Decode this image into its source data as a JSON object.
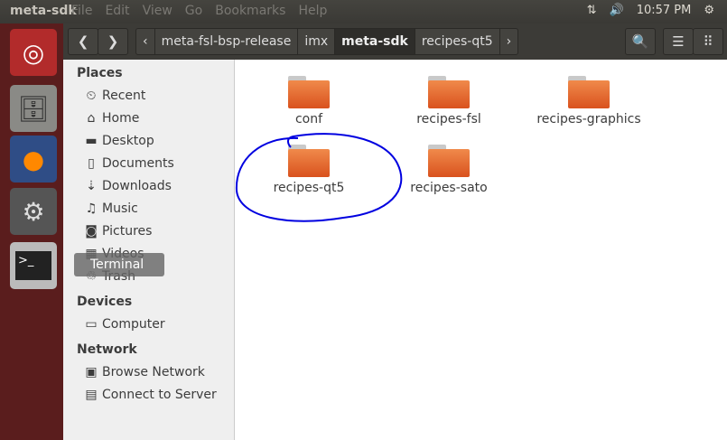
{
  "window_title": "meta-sdk",
  "menu": [
    "File",
    "Edit",
    "View",
    "Go",
    "Bookmarks",
    "Help"
  ],
  "indicators": {
    "clock": "10:57 PM"
  },
  "tooltip": "Terminal",
  "breadcrumb": [
    "meta-fsl-bsp-release",
    "imx",
    "meta-sdk",
    "recipes-qt5"
  ],
  "sidebar": {
    "places": "Places",
    "devices": "Devices",
    "network": "Network",
    "place_items": [
      {
        "label": "Recent",
        "icon": "⏲"
      },
      {
        "label": "Home",
        "icon": "⌂"
      },
      {
        "label": "Desktop",
        "icon": "▬"
      },
      {
        "label": "Documents",
        "icon": "▯"
      },
      {
        "label": "Downloads",
        "icon": "⇣"
      },
      {
        "label": "Music",
        "icon": "♫"
      },
      {
        "label": "Pictures",
        "icon": "◙"
      },
      {
        "label": "Videos",
        "icon": "▦"
      },
      {
        "label": "Trash",
        "icon": "♲"
      }
    ],
    "device_items": [
      {
        "label": "Computer",
        "icon": "▭"
      }
    ],
    "network_items": [
      {
        "label": "Browse Network",
        "icon": "▣"
      },
      {
        "label": "Connect to Server",
        "icon": "▤"
      }
    ]
  },
  "folders": [
    "conf",
    "recipes-fsl",
    "recipes-graphics",
    "recipes-qt5",
    "recipes-sato"
  ],
  "annotation_color": "#0000e0"
}
